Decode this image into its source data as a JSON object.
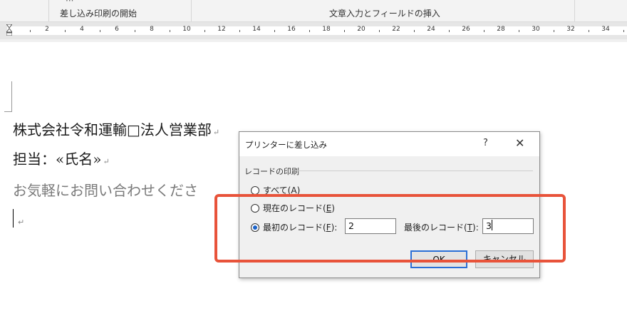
{
  "ribbon": {
    "group_mailmerge": "差し込み印刷の開始",
    "group_insert": "文章入力とフィールドの挿入"
  },
  "ruler": {
    "numbers": [
      "2",
      "4",
      "6",
      "8",
      "10",
      "12",
      "14",
      "16",
      "18",
      "20",
      "22",
      "24",
      "26",
      "28",
      "30",
      "32",
      "34"
    ]
  },
  "document": {
    "line1": "株式会社令和運輸□法人営業部",
    "line2": "担当：«氏名»",
    "line3": "お気軽にお問い合わせくださ",
    "para_mark": "↵"
  },
  "dialog": {
    "title": "プリンターに差し込み",
    "help": "?",
    "close": "✕",
    "group_label": "レコードの印刷",
    "options": {
      "all": {
        "label": "すべて(",
        "key": "A",
        "end": ")",
        "selected": false
      },
      "current": {
        "label": "現在のレコード(",
        "key": "E",
        "end": ")",
        "selected": false
      },
      "range": {
        "label": "最初のレコード(",
        "key": "F",
        "end": "):",
        "selected": true
      }
    },
    "first_record_value": "2",
    "last_record_label": {
      "label": "最後のレコード(",
      "key": "T",
      "end": "):"
    },
    "last_record_value": "3",
    "ok_label": "OK",
    "cancel_label": "キャンセル"
  },
  "colors": {
    "highlight": "#e8533a",
    "focus": "#2b6fd6"
  }
}
